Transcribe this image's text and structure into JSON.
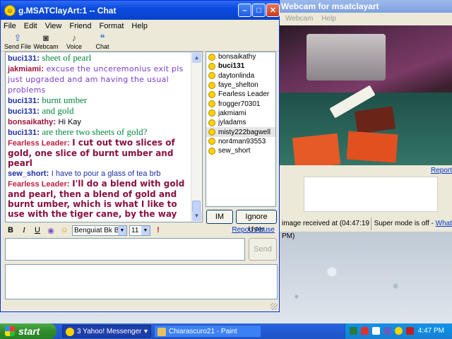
{
  "chat": {
    "title": "g.MSATClayArt:1 -- Chat",
    "menu": [
      "File",
      "Edit",
      "View",
      "Friend",
      "Format",
      "Help"
    ],
    "toolbar": [
      "Send File",
      "Webcam",
      "Voice",
      "Chat"
    ],
    "messages": [
      {
        "nick": "buci131",
        "text": "sheet of pearl",
        "nick_color": "#1a2ea8",
        "text_color": "#00883a",
        "text_font": "serif"
      },
      {
        "nick": "jakmiami",
        "text": "excuse the unceremonius exit pls just upgraded and am having the usual problems",
        "nick_color": "#a0103a",
        "text_color": "#7a3cc8",
        "text_font": "comic"
      },
      {
        "nick": "buci131",
        "text": "burnt umber",
        "nick_color": "#1a2ea8",
        "text_color": "#00883a",
        "text_font": "serif"
      },
      {
        "nick": "buci131",
        "text": "and gold",
        "nick_color": "#1a2ea8",
        "text_color": "#00883a",
        "text_font": "serif"
      },
      {
        "nick": "bonsaikathy",
        "text": "Hi Kay",
        "nick_color": "#a0103a",
        "text_color": "#000000",
        "text_font": "sans"
      },
      {
        "nick": "buci131",
        "text": "are there two sheets of gold?",
        "nick_color": "#1a2ea8",
        "text_color": "#00883a",
        "text_font": "serif"
      },
      {
        "nick": "Fearless Leader",
        "text": "I cut out two slices of gold, one slice of burnt umber and pearl",
        "nick_color": "#c02040",
        "text_color": "#8a1040",
        "text_font": "sansbold"
      },
      {
        "nick": "sew_short",
        "text": "I have to pour a glass of tea brb",
        "nick_color": "#1a2ea8",
        "text_color": "#1a2ea8",
        "text_font": "sans"
      },
      {
        "nick": "Fearless Leader",
        "text": "I'll do a blend with gold and pearl, then a blend of gold and burnt umber, which is what I like to use with the tiger cane, by the way",
        "nick_color": "#c02040",
        "text_color": "#8a1040",
        "text_font": "sansbold"
      }
    ],
    "users": [
      {
        "name": "bonsaikathy",
        "bold": false,
        "selected": false
      },
      {
        "name": "buci131",
        "bold": true,
        "selected": false
      },
      {
        "name": "daytonlinda",
        "bold": false,
        "selected": false
      },
      {
        "name": "faye_shelton",
        "bold": false,
        "selected": false
      },
      {
        "name": "Fearless Leader",
        "bold": false,
        "selected": false
      },
      {
        "name": "frogger70301",
        "bold": false,
        "selected": false
      },
      {
        "name": "jakmiami",
        "bold": false,
        "selected": false
      },
      {
        "name": "jyladams",
        "bold": false,
        "selected": false
      },
      {
        "name": "misty222bagwell",
        "bold": false,
        "selected": true
      },
      {
        "name": "nor4man93553",
        "bold": false,
        "selected": false
      },
      {
        "name": "sew_short",
        "bold": false,
        "selected": false
      }
    ],
    "im_label": "IM",
    "ignore_label": "Ignore User",
    "font_name": "Benguiat Bk BT",
    "font_size": "11",
    "report_abuse": "Report Abuse",
    "send_label": "Send"
  },
  "webcam": {
    "title": "Webcam for msatclayart",
    "menu": [
      "Webcam",
      "Help"
    ],
    "report_link": "Report",
    "status_left": "image received at (04:47:19 PM)",
    "status_right": "Super mode is off - ",
    "status_link": "What"
  },
  "taskbar": {
    "start": "start",
    "tasks": [
      "3 Yahoo! Messenger",
      "Chiarascuro21 - Paint"
    ],
    "clock": "4:47 PM"
  }
}
